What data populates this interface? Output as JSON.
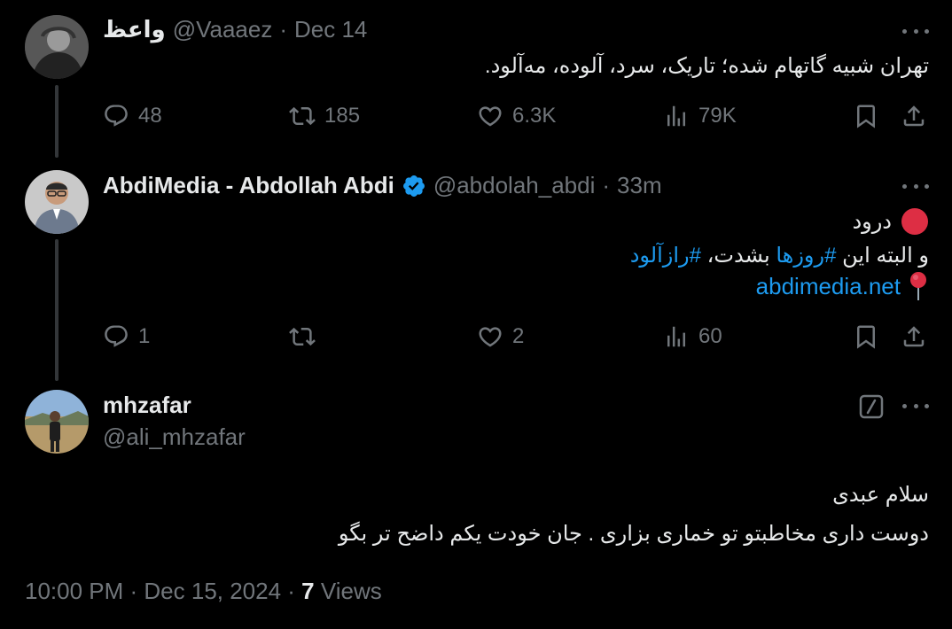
{
  "colors": {
    "background": "#000000",
    "text": "#e7e9ea",
    "muted": "#71767b",
    "accent": "#1d9bf0",
    "thread_line": "#333639"
  },
  "tweets": [
    {
      "display_name": "واعظ",
      "handle": "@Vaaaez",
      "time": "Dec 14",
      "text": "تهران شبیه گاتهام شده؛ تاریک، سرد، آلوده، مه‌آلود.",
      "replies": "48",
      "reposts": "185",
      "likes": "6.3K",
      "views": "79K"
    },
    {
      "display_name": "AbdiMedia - Abdollah Abdi",
      "verified": true,
      "handle": "@abdolah_abdi",
      "time": "33m",
      "line1": "درود",
      "line2_prefix": "و البته این ",
      "hashtag1": "#روزها",
      "line2_middle": " بشدت، ",
      "hashtag2": "#رازآلود",
      "link": "abdimedia.net",
      "line1_icon": "red-circle-icon",
      "link_icon": "round-pushpin-icon",
      "replies": "1",
      "reposts": "",
      "likes": "2",
      "views": "60"
    }
  ],
  "reply": {
    "display_name": "mhzafar",
    "handle": "@ali_mhzafar",
    "line1": "سلام عبدی",
    "line2": "دوست داری مخاطبتو تو خماری بزاری . جان خودت یکم داضح تر بگو",
    "timestamp": "10:00 PM · Dec 15, 2024 · ",
    "views_count": "7",
    "views_label": "Views"
  },
  "dot_separator": "·"
}
